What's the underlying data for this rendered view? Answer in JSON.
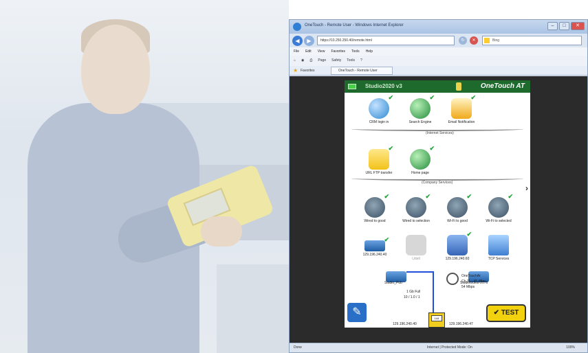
{
  "browser": {
    "title": "OneTouch - Remote User - Windows Internet Explorer",
    "url": "https://10.250.250.40/remote.html",
    "search_placeholder": "Bing",
    "menu": [
      "File",
      "Edit",
      "View",
      "Favorites",
      "Tools",
      "Help"
    ],
    "commands": [
      "Page",
      "Safety",
      "Tools"
    ],
    "favorites_label": "Favorites",
    "tab_label": "OneTouch - Remote User",
    "status_done": "Done",
    "status_zone": "Internet | Protected Mode: On",
    "zoom": "100%"
  },
  "device": {
    "profile": "Studio2020 v3",
    "brand": "OneTouch AT",
    "test_label": "✔ TEST",
    "group_external": "(Internet Services)",
    "group_company": "(Company Services)",
    "tiles_row1": [
      {
        "label": "CRM login in",
        "icon": "cloud-tcp-icon"
      },
      {
        "label": "Search Engine",
        "icon": "globe-icon"
      },
      {
        "label": "Email Notification",
        "icon": "mail-icon"
      }
    ],
    "tiles_row2": [
      {
        "label": "URL FTP transfer",
        "icon": "folder-icon"
      },
      {
        "label": "Home page",
        "icon": "globe-icon"
      }
    ],
    "tiles_row3": [
      {
        "label": "Wired to good",
        "icon": "wifi-icon"
      },
      {
        "label": "Wired to selection",
        "icon": "wifi-icon"
      },
      {
        "label": "Wi-Fi to good",
        "icon": "wifi-icon"
      },
      {
        "label": "Wi-Fi to selected",
        "icon": "wifi-icon"
      }
    ],
    "tiles_row4": [
      {
        "label": "129.196.240.40",
        "icon": "switch-icon"
      },
      {
        "label": "Udell",
        "icon": "server-icon"
      },
      {
        "label": "129.196.240.60",
        "icon": "dns-icon"
      },
      {
        "label": "TCP Services",
        "icon": "services-icon"
      }
    ],
    "topology": {
      "switch_label": "Studio_Pub",
      "ap_label": "StudioGuest-2076",
      "link_label": "1 Gb Full",
      "port_label": "10 / 1.0 / 1",
      "wifi_label": "OneTouchAt",
      "wifi_detail": "Ch 11, -45 dBm",
      "wifi_rate": "54 Mbps",
      "ip_left": "129.196.240.40",
      "ip_right": "129.196.240.47",
      "device_screen": "144"
    }
  }
}
